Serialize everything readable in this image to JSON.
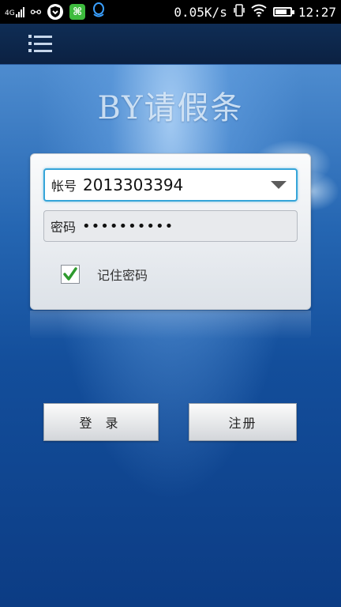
{
  "status_bar": {
    "network": "4G",
    "speed": "0.05K/s",
    "time": "12:27",
    "icons": [
      "signal-icon",
      "usb-icon",
      "shield-icon",
      "app-icon",
      "qq-icon",
      "vibrate-icon",
      "wifi-icon",
      "battery-icon"
    ]
  },
  "app_bar": {
    "menu_icon": "menu-icon"
  },
  "app_title": "BY请假条",
  "login_form": {
    "account_label": "帐号",
    "account_value": "2013303394",
    "password_label": "密码",
    "password_value": "••••••••••",
    "remember_label": "记住密码",
    "remember_checked": true
  },
  "buttons": {
    "login_label": "登 录",
    "register_label": "注册"
  },
  "colors": {
    "accent_border": "#36a5d9",
    "check_green": "#2e9a2e",
    "background_blue": "#134e9b"
  }
}
